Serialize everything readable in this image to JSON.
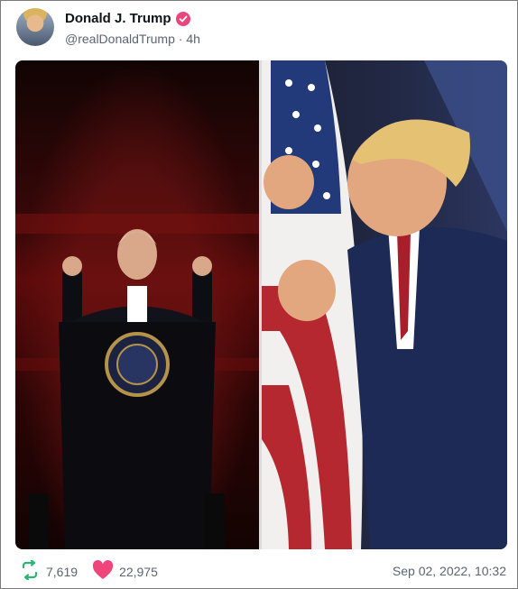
{
  "post": {
    "author": {
      "display_name": "Donald J. Trump",
      "handle": "@realDonaldTrump",
      "separator": "·",
      "time_ago": "4h",
      "verified_color": "#e8467c"
    },
    "media": {
      "left_icon": "photo-left-image",
      "right_icon": "photo-right-image"
    },
    "stats": {
      "retweets": "7,619",
      "likes": "22,975",
      "retweet_color": "#2bb673",
      "like_color": "#f0457a"
    },
    "timestamp": "Sep 02, 2022, 10:32"
  }
}
